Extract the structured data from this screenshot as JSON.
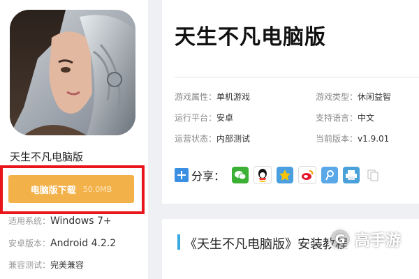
{
  "app": {
    "name": "天生不凡电脑版",
    "download_label": "电脑版下载",
    "download_size": "50.0MB"
  },
  "left_info": [
    {
      "key": "适用系统：",
      "value": "Windows 7+"
    },
    {
      "key": "安卓版本：",
      "value": "Android 4.2.2"
    },
    {
      "key": "兼容测试：",
      "value": "完美兼容"
    }
  ],
  "title": "天生不凡电脑版",
  "meta": [
    {
      "key": "游戏属性：",
      "value": "单机游戏"
    },
    {
      "key": "游戏类型：",
      "value": "休闲益智"
    },
    {
      "key": "运行平台：",
      "value": "安卓"
    },
    {
      "key": "支持语言：",
      "value": "中文"
    },
    {
      "key": "运营状态：",
      "value": "内部测试"
    },
    {
      "key": "当前版本：",
      "value": "v1.9.01"
    }
  ],
  "share": {
    "label": "分享：",
    "icons": [
      "wechat-icon",
      "qq-icon",
      "qzone-icon",
      "weibo-icon",
      "tencent-weibo-icon",
      "print-icon",
      "copy-icon"
    ]
  },
  "section": {
    "title": "《天生不凡电脑版》安装教程"
  },
  "watermark": {
    "text": "高手游"
  },
  "colors": {
    "download_button": "#f3b14a",
    "highlight_frame": "#e8161b",
    "section_accent": "#3aa9e0"
  }
}
